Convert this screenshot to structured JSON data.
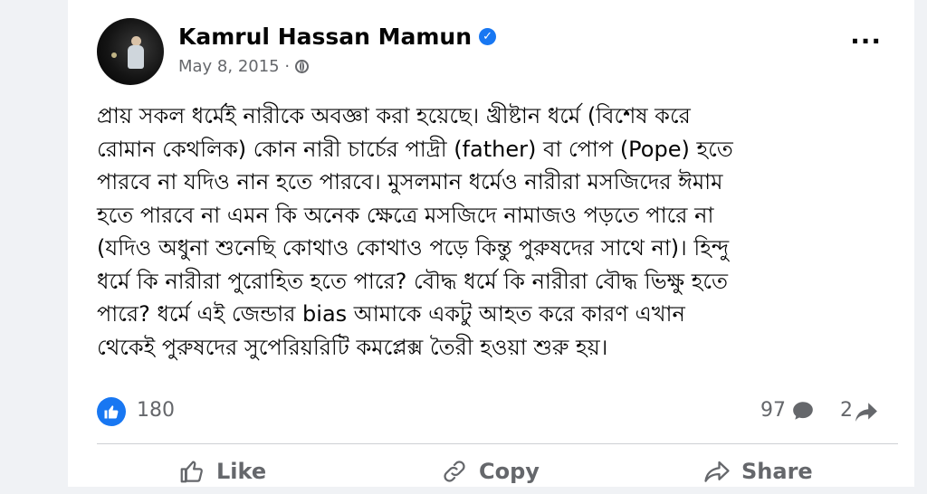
{
  "post": {
    "author": "Kamrul Hassan Mamun",
    "date": "May 8, 2015 ·",
    "text_lines": [
      "প্রায় সকল ধর্মেই নারীকে অবজ্ঞা করা হয়েছে। খ্রীষ্টান ধর্মে (বিশেষ করে",
      "রোমান কেথলিক) কোন নারী চার্চের পাদ্রী (father) বা পোপ (Pope) হতে",
      "পারবে না যদিও নান হতে পারবে। মুসলমান ধর্মেও নারীরা মসজিদের ঈমাম",
      "হতে পারবে না এমন কি অনেক ক্ষেত্রে মসজিদে নামাজও পড়তে পারে না",
      "(যদিও অধুনা শুনেছি কোথাও কোথাও পড়ে কিন্তু পুরুষদের সাথে না)। হিন্দু",
      "ধর্মে কি নারীরা পুরোহিত হতে পারে? বৌদ্ধ ধর্মে কি নারীরা বৌদ্ধ ভিক্ষু হতে",
      "পারে? ধর্মে এই জেন্ডার bias আমাকে একটু আহত করে কারণ এখান",
      "থেকেই পুরুষদের সুপেরিয়রিটি কমপ্লেক্স তৈরী হওয়া শুরু হয়।"
    ]
  },
  "stats": {
    "reactions": "180",
    "comments": "97",
    "shares": "2"
  },
  "actions": {
    "like": "Like",
    "copy": "Copy",
    "share": "Share"
  },
  "colors": {
    "accent": "#1877f2",
    "muted": "#65676b",
    "text": "#050505"
  },
  "icons": [
    "verified-icon",
    "globe-icon",
    "more-options-icon",
    "like-reaction-icon",
    "comment-icon",
    "share-icon",
    "like-icon",
    "copy-icon"
  ]
}
